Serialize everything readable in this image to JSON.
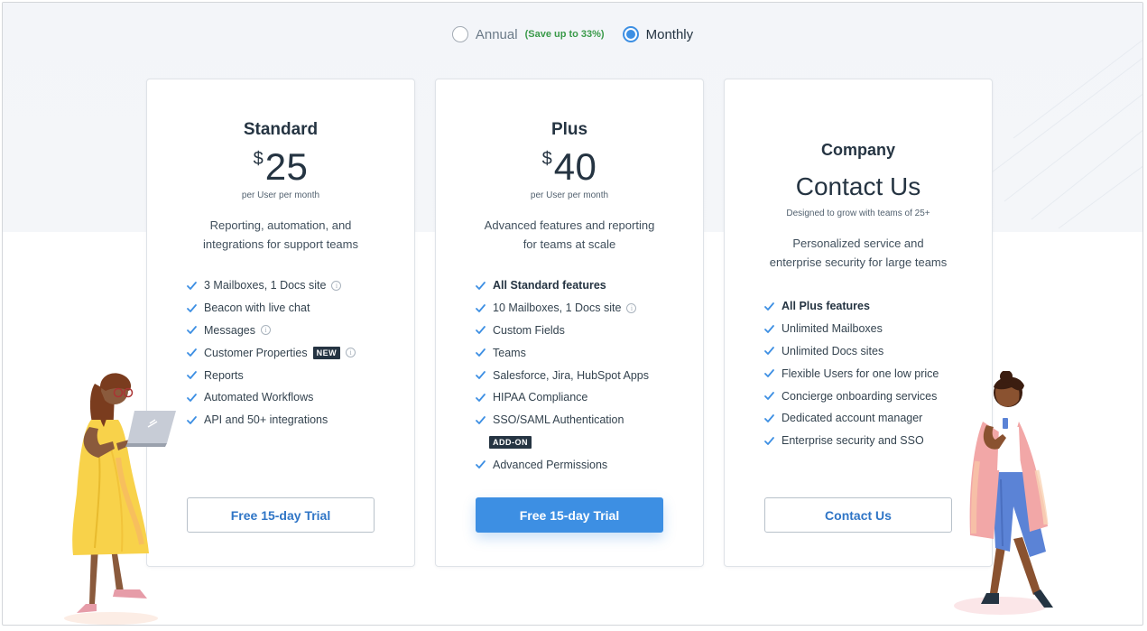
{
  "billing_toggle": {
    "annual_label": "Annual",
    "annual_note": "(Save up to 33%)",
    "monthly_label": "Monthly",
    "selected": "Monthly"
  },
  "colors": {
    "accent": "#3d8fe3",
    "save_note": "#3a9a4a",
    "badge": "#253442",
    "text": "#253442"
  },
  "plans": {
    "standard": {
      "name": "Standard",
      "currency": "$",
      "price": "25",
      "per": "per User per month",
      "desc_line1": "Reporting, automation, and",
      "desc_line2": "integrations for support teams",
      "features": [
        "3 Mailboxes, 1 Docs site",
        "Beacon with live chat",
        "Messages",
        "Customer Properties",
        "Reports",
        "Automated Workflows",
        "API and 50+ integrations"
      ],
      "new_badge": "NEW",
      "button": "Free 15-day Trial"
    },
    "plus": {
      "name": "Plus",
      "currency": "$",
      "price": "40",
      "per": "per User per month",
      "desc_line1": "Advanced features and reporting",
      "desc_line2": "for teams at scale",
      "features": [
        "All Standard features",
        "10 Mailboxes, 1 Docs site",
        "Custom Fields",
        "Teams",
        "Salesforce, Jira, HubSpot Apps",
        "HIPAA Compliance",
        "SSO/SAML Authentication",
        "Advanced Permissions"
      ],
      "addon_badge": "ADD-ON",
      "button": "Free 15-day Trial"
    },
    "company": {
      "name": "Company",
      "headline": "Contact Us",
      "per": "Designed to grow with teams of 25+",
      "desc_line1": "Personalized service and",
      "desc_line2": "enterprise security for large teams",
      "features": [
        "All Plus features",
        "Unlimited Mailboxes",
        "Unlimited Docs sites",
        "Flexible Users for one low price",
        "Concierge onboarding services",
        "Dedicated account manager",
        "Enterprise security and SSO"
      ],
      "button": "Contact Us"
    }
  }
}
